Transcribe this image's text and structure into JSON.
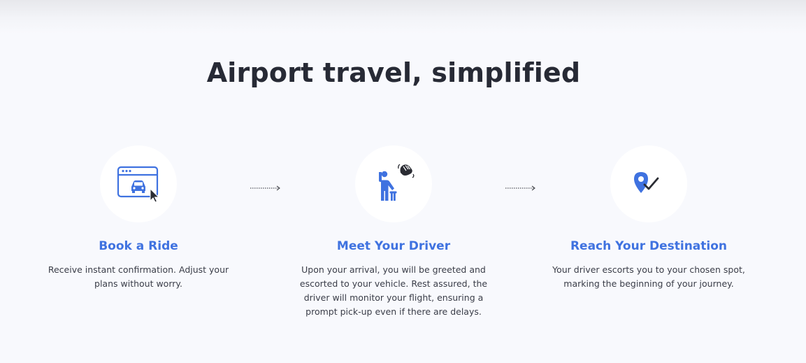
{
  "page": {
    "title": "Airport travel, simplified"
  },
  "steps": [
    {
      "icon": "browser-car-cursor-icon",
      "title": "Book a Ride",
      "description": "Receive instant confirmation. Adjust your plans without worry."
    },
    {
      "icon": "waving-person-icon",
      "title": "Meet Your Driver",
      "description": "Upon your arrival, you will be greeted and escorted to your vehicle. Rest assured, the driver will monitor your flight, ensuring a prompt pick-up even if there are delays."
    },
    {
      "icon": "location-pin-check-icon",
      "title": "Reach Your Destination",
      "description": "Your driver escorts you to your chosen spot, marking the beginning of your journey."
    }
  ],
  "colors": {
    "accent": "#3f72e0",
    "heading": "#272a35",
    "text": "#3a3d48",
    "background": "#f8f9fd",
    "icon_circle": "#ffffff",
    "dark_icon": "#2a2c33"
  }
}
